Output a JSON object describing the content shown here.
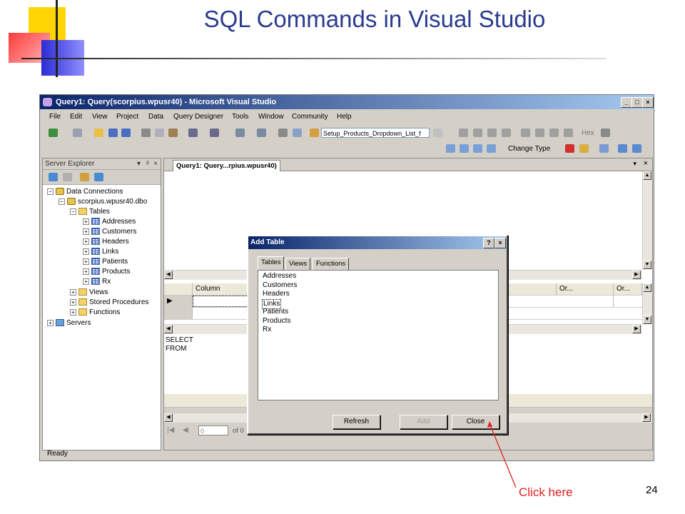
{
  "slide": {
    "title": "SQL Commands in Visual Studio",
    "page_number": "24",
    "callout": "Click here",
    "callout_color": "#e02020",
    "title_color": "#2a3b8f"
  },
  "window": {
    "title": "Query1: Query(scorpius.wpusr40) - Microsoft Visual Studio",
    "title_color": "#0a246a"
  },
  "menu": [
    "File",
    "Edit",
    "View",
    "Project",
    "Data",
    "Query Designer",
    "Tools",
    "Window",
    "Community",
    "Help"
  ],
  "toolbar": {
    "config_combo": "Setup_Products_Dropdown_List_f",
    "hex_label": "Hex",
    "change_type_label": "Change Type"
  },
  "server_explorer": {
    "title": "Server Explorer",
    "nodes": {
      "data_connections": "Data Connections",
      "connection": "scorpius.wpusr40.dbo",
      "tables": "Tables",
      "table_items": [
        "Addresses",
        "Customers",
        "Headers",
        "Links",
        "Patients",
        "Products",
        "Rx"
      ],
      "views": "Views",
      "stored_procedures": "Stored Procedures",
      "functions": "Functions",
      "servers": "Servers"
    }
  },
  "document": {
    "tab_label": "Query1: Query...rpius.wpusr40)",
    "grid_headers": {
      "column": "Column",
      "filter_partial": "er",
      "or1": "Or...",
      "or2": "Or..."
    },
    "sql_lines": [
      "SELECT",
      "FROM"
    ],
    "nav": {
      "record_value": "0",
      "of_label": "of 0"
    }
  },
  "dialog": {
    "title": "Add Table",
    "tabs": [
      "Tables",
      "Views",
      "Functions"
    ],
    "active_tab": "Tables",
    "items": [
      "Addresses",
      "Customers",
      "Headers",
      "Links",
      "Patients",
      "Products",
      "Rx"
    ],
    "focused_item": "Links",
    "buttons": {
      "refresh": "Refresh",
      "add": "Add",
      "close": "Close"
    }
  },
  "statusbar": {
    "text": "Ready"
  }
}
